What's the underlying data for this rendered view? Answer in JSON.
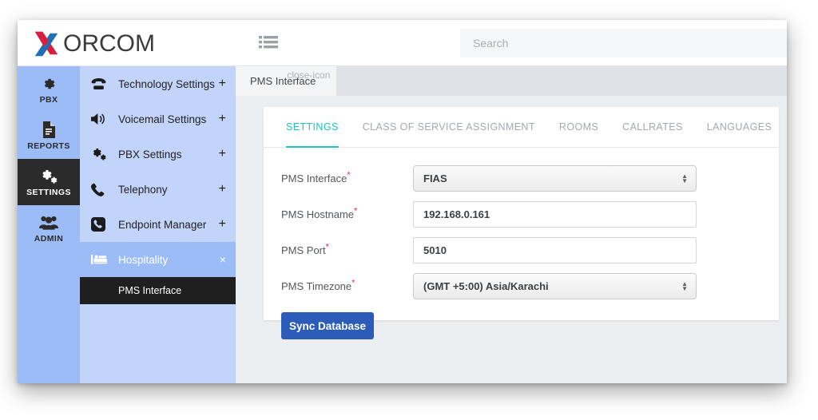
{
  "header": {
    "logo_text": "ORCOM",
    "logo_icon": "xorcom-x-logo",
    "list_toggle_icon": "list-icon",
    "search_placeholder": "Search",
    "search_value": ""
  },
  "icon_rail": {
    "items": [
      {
        "label": "PBX",
        "icon": "gear-icon",
        "active": false
      },
      {
        "label": "REPORTS",
        "icon": "document-icon",
        "active": false
      },
      {
        "label": "SETTINGS",
        "icon": "gears-icon",
        "active": true
      },
      {
        "label": "ADMIN",
        "icon": "users-icon",
        "active": false
      }
    ]
  },
  "menu_panel": {
    "items": [
      {
        "label": "Technology Settings",
        "suffix": "+",
        "icon": "telephone-icon",
        "active": false
      },
      {
        "label": "Voicemail Settings",
        "suffix": "+",
        "icon": "speaker-icon",
        "active": false
      },
      {
        "label": "PBX Settings",
        "suffix": "+",
        "icon": "gears-icon",
        "active": false
      },
      {
        "label": "Telephony",
        "suffix": "+",
        "icon": "phone-handset-icon",
        "active": false
      },
      {
        "label": "Endpoint Manager",
        "suffix": "+",
        "icon": "device-phone-icon",
        "active": false
      },
      {
        "label": "Hospitality",
        "suffix": "×",
        "icon": "bed-icon",
        "active": true
      }
    ],
    "submenu": [
      {
        "label": "PMS Interface"
      }
    ]
  },
  "main": {
    "document_tab": {
      "label": "PMS Interface",
      "close_icon": "close-icon"
    },
    "subtabs": [
      {
        "label": "SETTINGS",
        "active": true
      },
      {
        "label": "CLASS OF SERVICE ASSIGNMENT",
        "active": false
      },
      {
        "label": "ROOMS",
        "active": false
      },
      {
        "label": "CALLRATES",
        "active": false
      },
      {
        "label": "LANGUAGES",
        "active": false
      }
    ],
    "form": {
      "fields": [
        {
          "label": "PMS Interface",
          "required": "*",
          "type": "select",
          "value": "FIAS"
        },
        {
          "label": "PMS Hostname",
          "required": "*",
          "type": "text",
          "value": "192.168.0.161"
        },
        {
          "label": "PMS Port",
          "required": "*",
          "type": "text",
          "value": "5010"
        },
        {
          "label": "PMS Timezone",
          "required": "*",
          "type": "select",
          "value": "(GMT +5:00) Asia/Karachi"
        }
      ],
      "sync_button": "Sync Database"
    }
  },
  "colors": {
    "accent_teal": "#1ec4bb",
    "button_blue": "#2b5cb8",
    "rail_blue": "#9cbcf7",
    "menu_blue": "#c3d4fb",
    "active_dark": "#2b2b2b",
    "required_red": "#e02b4d"
  }
}
